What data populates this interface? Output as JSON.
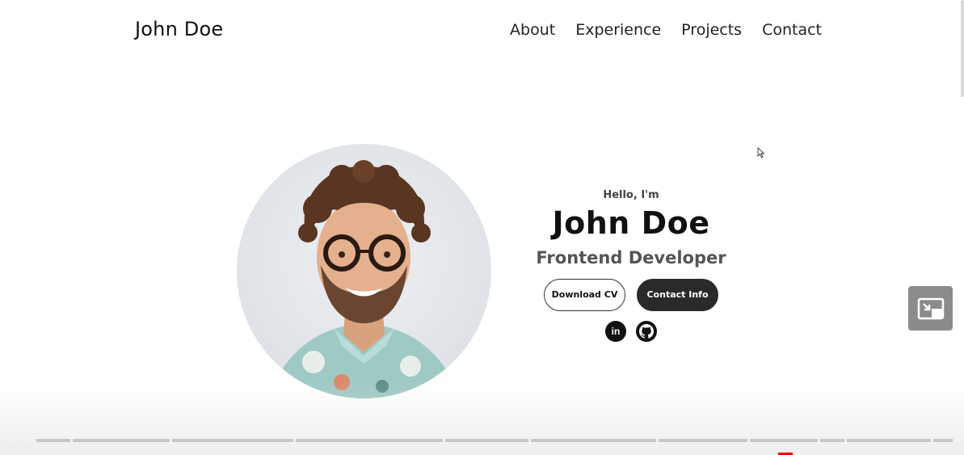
{
  "nav": {
    "logo": "John Doe",
    "links": [
      "About",
      "Experience",
      "Projects",
      "Contact"
    ]
  },
  "hero": {
    "greeting": "Hello, I'm",
    "name": "John Doe",
    "role": "Frontend Developer",
    "download_cv_label": "Download CV",
    "contact_info_label": "Contact Info",
    "social_icons": [
      "linkedin-icon",
      "github-icon"
    ],
    "linkedin_glyph": "in"
  },
  "video_player": {
    "pip_icon": "picture-in-picture-icon",
    "accent_color": "#e00000"
  },
  "colors": {
    "primary_button": "#2a2a2a",
    "text": "#111111",
    "role_text": "#555555"
  }
}
